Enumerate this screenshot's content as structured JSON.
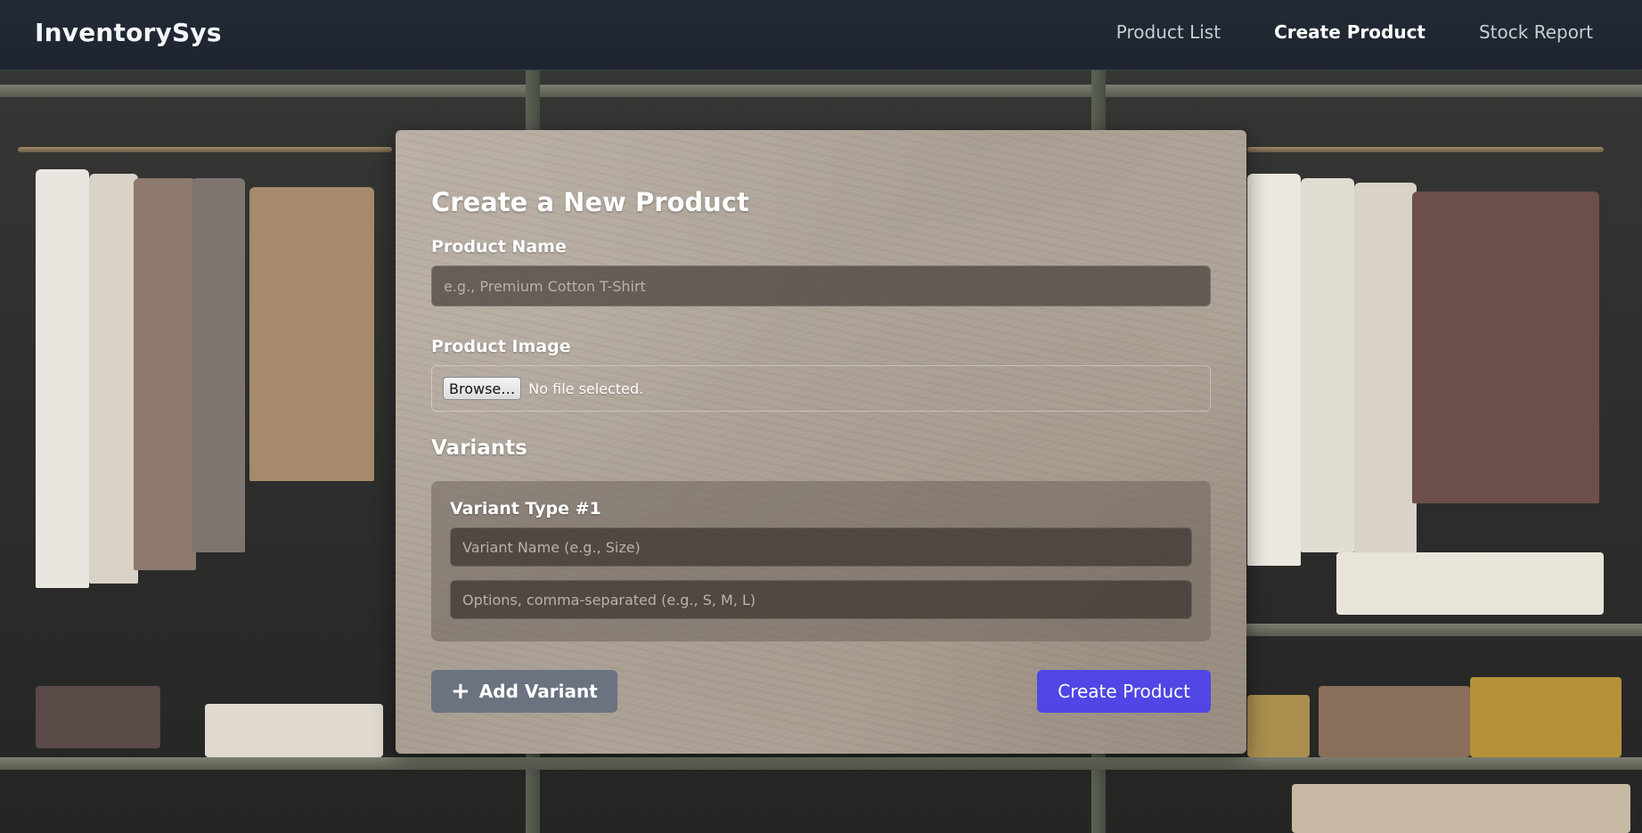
{
  "app": {
    "brand": "InventorySys"
  },
  "nav": {
    "items": [
      {
        "label": "Product List",
        "active": false
      },
      {
        "label": "Create Product",
        "active": true
      },
      {
        "label": "Stock Report",
        "active": false
      }
    ]
  },
  "form": {
    "title": "Create a New Product",
    "product_name": {
      "label": "Product Name",
      "value": "",
      "placeholder": "e.g., Premium Cotton T-Shirt"
    },
    "product_image": {
      "label": "Product Image",
      "browse_label": "Browse…",
      "status": "No file selected."
    },
    "variants": {
      "title": "Variants",
      "items": [
        {
          "title": "Variant Type #1",
          "name_placeholder": "Variant Name (e.g., Size)",
          "name_value": "",
          "options_placeholder": "Options, comma-separated (e.g., S, M, L)",
          "options_value": ""
        }
      ]
    },
    "add_variant_label": "Add Variant",
    "add_variant_icon": "plus-icon",
    "submit_label": "Create Product"
  },
  "colors": {
    "navbar": "#222a35",
    "primary_button": "#4f46e5",
    "secondary_button": "#6b7280"
  }
}
